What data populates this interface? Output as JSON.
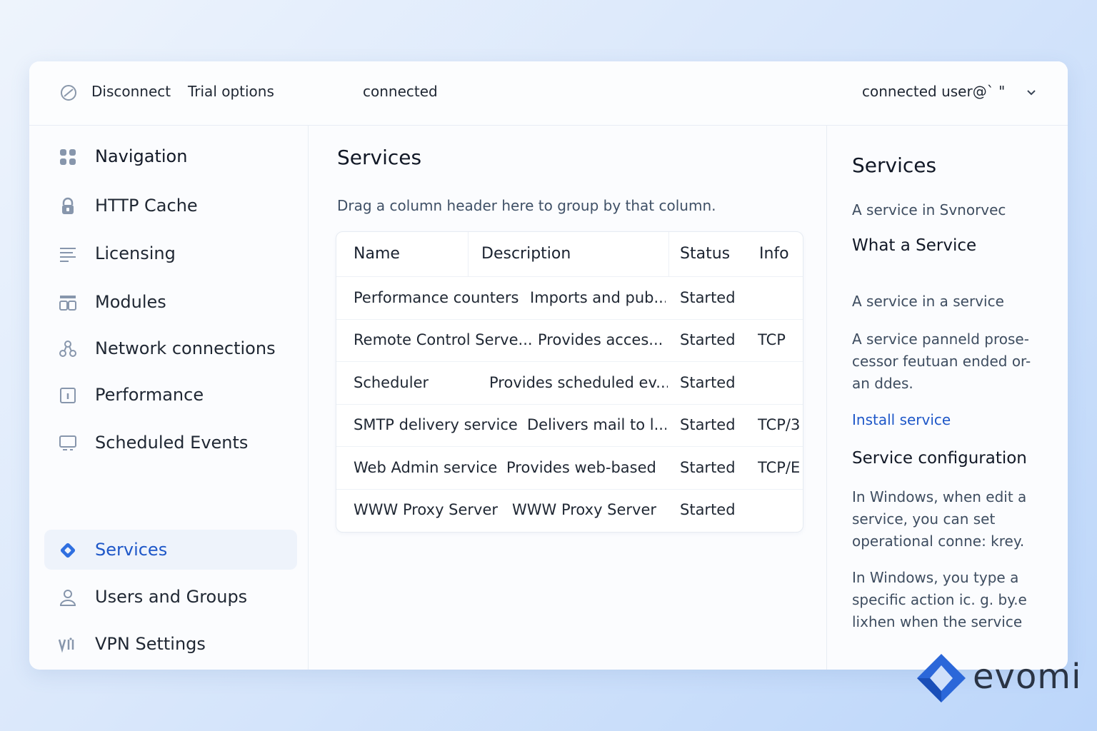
{
  "topbar": {
    "disconnect_label": "Disconnect",
    "trial_label": "Trial options",
    "status_text": "connected",
    "user_text": "connected user@` \""
  },
  "sidebar": {
    "items": [
      {
        "label": "Navigation",
        "icon": "grid-icon"
      },
      {
        "label": "HTTP Cache",
        "icon": "lock-icon"
      },
      {
        "label": "Licensing",
        "icon": "list-icon"
      },
      {
        "label": "Modules",
        "icon": "modules-icon"
      },
      {
        "label": "Network connections",
        "icon": "network-icon"
      },
      {
        "label": "Performance",
        "icon": "performance-icon"
      },
      {
        "label": "Scheduled Events",
        "icon": "monitor-icon"
      },
      {
        "label": "Services",
        "icon": "diamond-icon",
        "active": true
      },
      {
        "label": "Users and Groups",
        "icon": "user-icon"
      },
      {
        "label": "VPN Settings",
        "icon": "vpn-icon"
      }
    ]
  },
  "main": {
    "title": "Services",
    "group_hint": "Drag a column header here to group by that column.",
    "columns": [
      "Name",
      "Description",
      "Status",
      "Info"
    ],
    "rows": [
      {
        "name": "Performance counters",
        "description": "Imports and pub...",
        "status": "Started",
        "info": ""
      },
      {
        "name": "Remote Control Serve...",
        "description": "Provides acces...",
        "status": "Started",
        "info": "TCP"
      },
      {
        "name": "Scheduler",
        "description": "Provides scheduled ev...",
        "status": "Started",
        "info": ""
      },
      {
        "name": "SMTP delivery service",
        "description": "Delivers mail to l...",
        "status": "Started",
        "info": "TCP/3"
      },
      {
        "name": "Web Admin service",
        "description": "Provides web-based",
        "status": "Started",
        "info": "TCP/E"
      },
      {
        "name": "WWW Proxy Server",
        "description": "WWW Proxy Server",
        "status": "Started",
        "info": ""
      }
    ]
  },
  "rightpane": {
    "title": "Services",
    "intro": "A service in Svnorvec",
    "heading": "What a Service",
    "p1": "A service in a service",
    "p2": "A service panneld prose-cessor feutuan ended or-an ddes.",
    "link": "Install service",
    "heading2": "Service configuration",
    "p3": "In Windows, when edit a service, you can set operational conne: krey.",
    "p4": "In Windows, you type a specific action ic. g. by.e lixhen when the service"
  },
  "watermark": {
    "text": "evomi"
  },
  "colors": {
    "accent": "#1e57c8",
    "icon": "#7f8fa6",
    "active_bg": "#eef3fb"
  }
}
